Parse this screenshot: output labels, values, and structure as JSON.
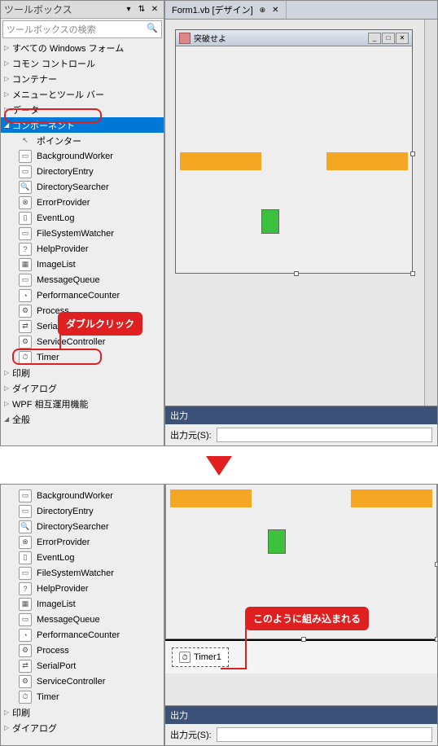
{
  "toolbox": {
    "title": "ツールボックス",
    "search_placeholder": "ツールボックスの検索",
    "categories_top": [
      {
        "label": "すべての Windows フォーム",
        "expanded": false
      },
      {
        "label": "コモン コントロール",
        "expanded": false
      },
      {
        "label": "コンテナー",
        "expanded": false
      },
      {
        "label": "メニューとツール バー",
        "expanded": false
      },
      {
        "label": "データ",
        "expanded": false
      }
    ],
    "component_category": "コンポーネント",
    "pointer_label": "ポインター",
    "components": [
      "BackgroundWorker",
      "DirectoryEntry",
      "DirectorySearcher",
      "ErrorProvider",
      "EventLog",
      "FileSystemWatcher",
      "HelpProvider",
      "ImageList",
      "MessageQueue",
      "PerformanceCounter",
      "Process",
      "SerialPort",
      "ServiceController",
      "Timer"
    ],
    "categories_bottom": [
      {
        "label": "印刷",
        "expanded": false
      },
      {
        "label": "ダイアログ",
        "expanded": false
      },
      {
        "label": "WPF 相互運用機能",
        "expanded": false
      },
      {
        "label": "全般",
        "expanded": true
      }
    ]
  },
  "designer": {
    "tab_label": "Form1.vb [デザイン]",
    "form_title": "突破せよ",
    "tray_item": "Timer1"
  },
  "output": {
    "header": "出力",
    "source_label": "出力元(S):"
  },
  "callouts": {
    "double_click": "ダブルクリック",
    "embedded": "このように組み込まれる"
  }
}
